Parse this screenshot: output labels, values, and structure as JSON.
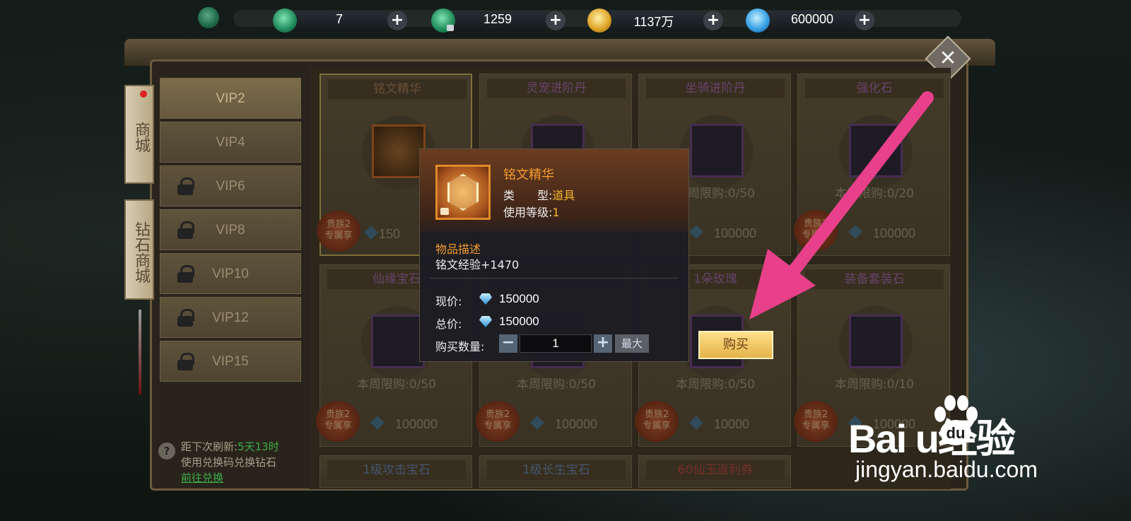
{
  "currencies": [
    {
      "icon": "jade-icon",
      "value": "7"
    },
    {
      "icon": "bound-jade-icon",
      "value": "1259"
    },
    {
      "icon": "gold-ingot-icon",
      "value": "1137万"
    },
    {
      "icon": "diamond-icon",
      "value": "600000"
    }
  ],
  "plus_symbol": "+",
  "close_symbol": "✕",
  "side_tabs": [
    "商城",
    "钻石商城"
  ],
  "vip_tabs": [
    {
      "label": "VIP2",
      "locked": false
    },
    {
      "label": "VIP4",
      "locked": false
    },
    {
      "label": "VIP6",
      "locked": true
    },
    {
      "label": "VIP8",
      "locked": true
    },
    {
      "label": "VIP10",
      "locked": true
    },
    {
      "label": "VIP12",
      "locked": true
    },
    {
      "label": "VIP15",
      "locked": true
    }
  ],
  "refresh": {
    "icon": "?",
    "prefix": "距下次刷新:",
    "time": "5天13时",
    "redeem_hint": "使用兑换码兑换钻石",
    "redeem_link": "前往兑换"
  },
  "items": [
    {
      "name": "铭文精华",
      "limit": "",
      "price": "150",
      "badge": "贵族2\n专属享"
    },
    {
      "name": "灵宠进阶丹",
      "limit": "",
      "price": "",
      "badge": ""
    },
    {
      "name": "坐骑进阶丹",
      "limit": "本周限购:0/50",
      "price": "100000",
      "badge": ""
    },
    {
      "name": "强化石",
      "limit": "本周限购:0/20",
      "price": "100000",
      "badge": "贵族2\n专属享"
    },
    {
      "name": "仙缘宝石",
      "limit": "本周限购:0/50",
      "price": "100000",
      "badge": "贵族2\n专属享"
    },
    {
      "name": "",
      "limit": "本周限购:0/50",
      "price": "100000",
      "badge": "贵族2\n专属享"
    },
    {
      "name": "1朵玫瑰",
      "limit": "本周限购:0/50",
      "price": "10000",
      "badge": "贵族2\n专属享"
    },
    {
      "name": "装备套装石",
      "limit": "本周限购:0/10",
      "price": "100000",
      "badge": "贵族2\n专属享"
    },
    {
      "name": "1级攻击宝石"
    },
    {
      "name": "1级长生宝石"
    },
    {
      "name": "60仙玉返利券"
    }
  ],
  "tooltip": {
    "title": "铭文精华",
    "type_label": "类　　型:",
    "type_value": "道具",
    "level_label": "使用等级:",
    "level_value": "1",
    "desc_heading": "物品描述",
    "desc": "铭文经验+1470",
    "current_price_label": "现价:",
    "current_price": "150000",
    "total_price_label": "总价:",
    "total_price": "150000",
    "qty_label": "购买数量:",
    "qty_value": "1",
    "minus": "−",
    "plus": "+",
    "max_label": "最大"
  },
  "buy_label": "购买",
  "watermark": {
    "logo": "Bai  u经验",
    "site": "jingyan.baidu.com"
  },
  "colors": {
    "arrow": "#e8408a",
    "highlight_green": "#3fae4a",
    "tooltip_orange": "#f39a2e",
    "value_gold": "#f5b82e"
  }
}
